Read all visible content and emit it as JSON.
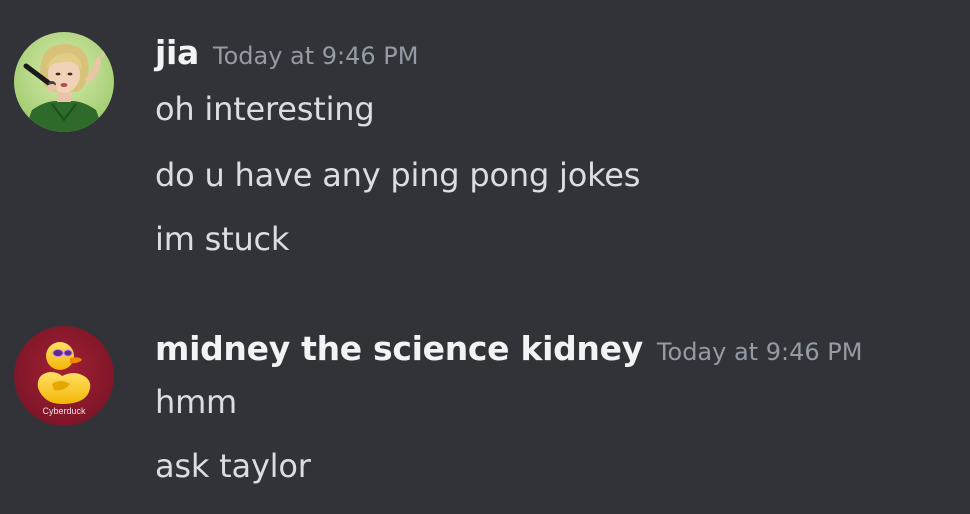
{
  "messages": [
    {
      "username": "jia",
      "timestamp": "Today at 9:46 PM",
      "avatar_icon": "person-with-microphone-avatar",
      "lines": [
        "oh interesting",
        "do u have any ping pong jokes",
        "im stuck"
      ]
    },
    {
      "username": "midney the science kidney",
      "timestamp": "Today at 9:46 PM",
      "avatar_icon": "cyberduck-avatar",
      "avatar_label": "Cyberduck",
      "lines": [
        "hmm",
        "ask taylor"
      ]
    }
  ],
  "colors": {
    "background": "#313338",
    "username": "#f2f3f5",
    "timestamp": "#949ba4",
    "message_text": "#dbdee1",
    "duck_avatar_bg": "#8b1a2b",
    "duck_yellow": "#f5c518"
  }
}
